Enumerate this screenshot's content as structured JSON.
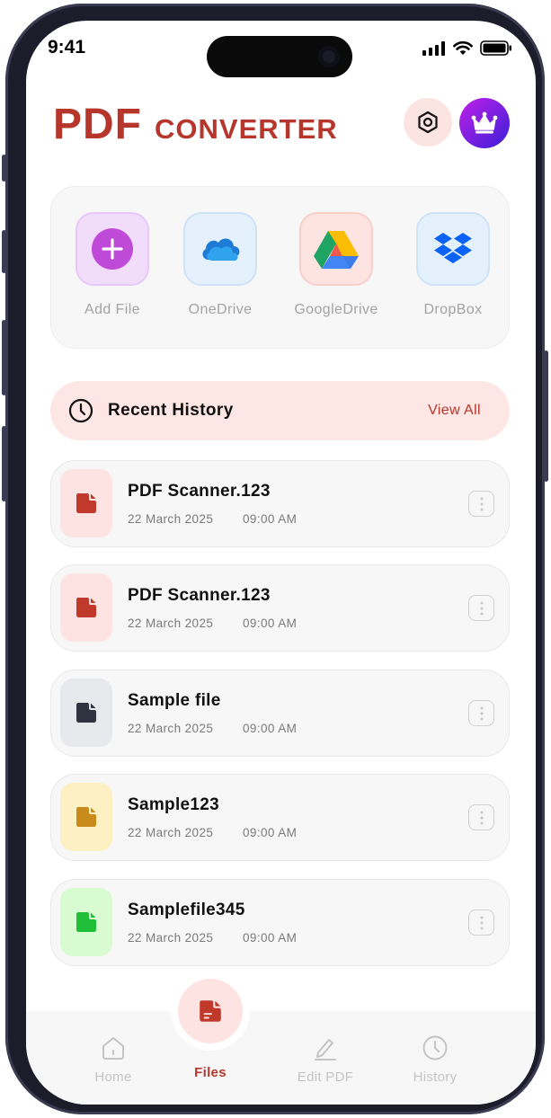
{
  "status": {
    "time": "9:41"
  },
  "header": {
    "title_big": "PDF",
    "title_small": "CONVERTER"
  },
  "sources": [
    {
      "label": "Add File",
      "icon": "plus-icon"
    },
    {
      "label": "OneDrive",
      "icon": "onedrive-icon"
    },
    {
      "label": "GoogleDrive",
      "icon": "googledrive-icon"
    },
    {
      "label": "DropBox",
      "icon": "dropbox-icon"
    }
  ],
  "history": {
    "title": "Recent History",
    "view_all": "View All"
  },
  "files": [
    {
      "name": "PDF Scanner.123",
      "date": "22 March 2025",
      "time": "09:00 AM",
      "color": "#c0392b",
      "bg": "#fde4e2"
    },
    {
      "name": "PDF Scanner.123",
      "date": "22 March 2025",
      "time": "09:00 AM",
      "color": "#c0392b",
      "bg": "#fde4e2"
    },
    {
      "name": "Sample file",
      "date": "22 March 2025",
      "time": "09:00 AM",
      "color": "#2f3440",
      "bg": "#e7e9ed"
    },
    {
      "name": "Sample123",
      "date": "22 March 2025",
      "time": "09:00 AM",
      "color": "#c78a1b",
      "bg": "#fdf0c2"
    },
    {
      "name": "Samplefile345",
      "date": "22 March 2025",
      "time": "09:00 AM",
      "color": "#1fbf3a",
      "bg": "#d8fbd2"
    }
  ],
  "tabs": [
    {
      "label": "Home",
      "icon": "home-icon"
    },
    {
      "label": "Files",
      "icon": "file-icon",
      "active": true
    },
    {
      "label": "Edit PDF",
      "icon": "pencil-icon"
    },
    {
      "label": "History",
      "icon": "clock-icon"
    }
  ],
  "colors": {
    "accent": "#b6362c",
    "accent_light": "#fde6e3",
    "premium_from": "#c020e8",
    "premium_to": "#3a1fd8"
  }
}
